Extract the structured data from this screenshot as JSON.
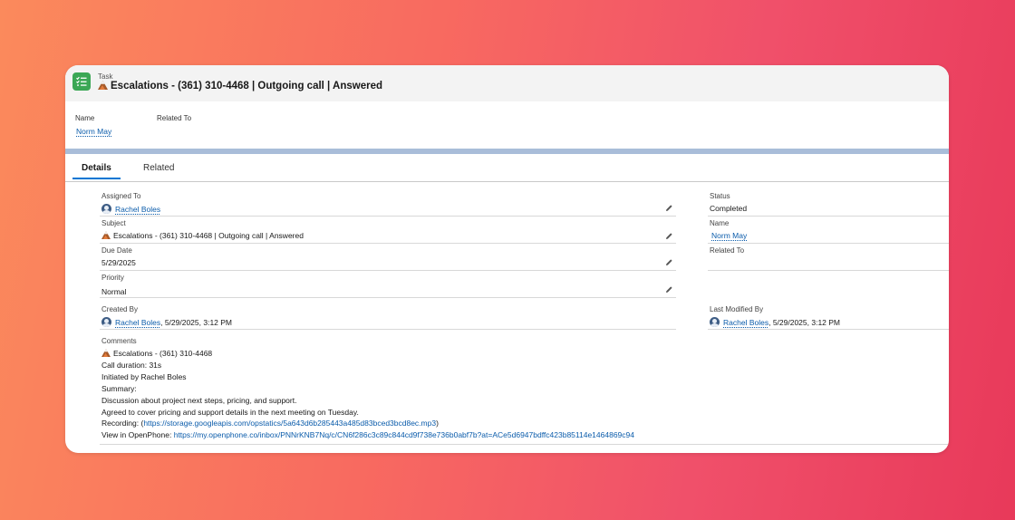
{
  "header": {
    "object_label": "Task",
    "title": "Escalations - (361) 310-4468 | Outgoing call | Answered"
  },
  "highlights": {
    "name_label": "Name",
    "related_label": "Related To",
    "name_value": "Norm May"
  },
  "tabs": [
    {
      "label": "Details",
      "active": true
    },
    {
      "label": "Related",
      "active": false
    }
  ],
  "details": {
    "assigned_to": {
      "label": "Assigned To",
      "value": "Rachel Boles"
    },
    "subject": {
      "label": "Subject",
      "value": "Escalations - (361) 310-4468 | Outgoing call | Answered"
    },
    "due_date": {
      "label": "Due Date",
      "value": "5/29/2025"
    },
    "priority": {
      "label": "Priority",
      "value": "Normal"
    },
    "created_by": {
      "label": "Created By",
      "user": "Rachel Boles",
      "date": ", 5/29/2025, 3:12 PM"
    },
    "status": {
      "label": "Status",
      "value": "Completed"
    },
    "name": {
      "label": "Name",
      "value": "Norm May"
    },
    "related_to": {
      "label": "Related To",
      "value": ""
    },
    "last_modified_by": {
      "label": "Last Modified By",
      "user": "Rachel Boles",
      "date": ", 5/29/2025, 3:12 PM"
    }
  },
  "comments": {
    "label": "Comments",
    "first_line": "Escalations - (361) 310-4468",
    "lines": [
      "Call duration: 31s",
      "Initiated by Rachel Boles",
      "Summary:",
      "Discussion about project next steps, pricing, and support.",
      "Agreed to cover pricing and support details in the next meeting on Tuesday."
    ],
    "recording_prefix": "Recording: (",
    "recording_url": "https://storage.googleapis.com/opstatics/5a643d6b285443a485d83bced3bcd8ec.mp3",
    "recording_suffix": ")",
    "view_prefix": "View in OpenPhone: ",
    "view_url": "https://my.openphone.co/inbox/PNNrKNB7Nq/c/CN6f286c3c89c844cd9f738e736b0abf7b?at=ACe5d6947bdffc423b85114e1464869c94"
  },
  "colors": {
    "link": "#0b5cab",
    "task_icon": "#3ba755",
    "band": "#a9bdd9",
    "tab_accent": "#0176d3"
  },
  "icons": [
    "task-icon",
    "mountain-icon",
    "user-avatar-icon",
    "pencil-icon"
  ]
}
